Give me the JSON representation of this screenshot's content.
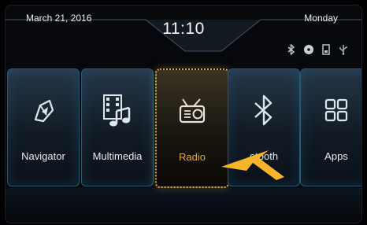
{
  "status_bar": {
    "date": "March 21, 2016",
    "time": "11:10",
    "day": "Monday"
  },
  "status_icons": [
    "bluetooth-icon",
    "disc-icon",
    "sd-card-icon",
    "usb-icon"
  ],
  "tiles": [
    {
      "label": "Navigator",
      "icon": "navigation-icon"
    },
    {
      "label": "Multimedia",
      "icon": "multimedia-icon"
    },
    {
      "label": "Radio",
      "icon": "radio-icon",
      "selected": true
    },
    {
      "label": "etooth",
      "icon": "bluetooth-icon"
    },
    {
      "label": "Apps",
      "icon": "apps-grid-icon"
    }
  ],
  "colors": {
    "accent": "#f0a526",
    "pointer": "#f6b52a",
    "tile_border": "#1d5d7a",
    "text": "#e6eaef"
  }
}
